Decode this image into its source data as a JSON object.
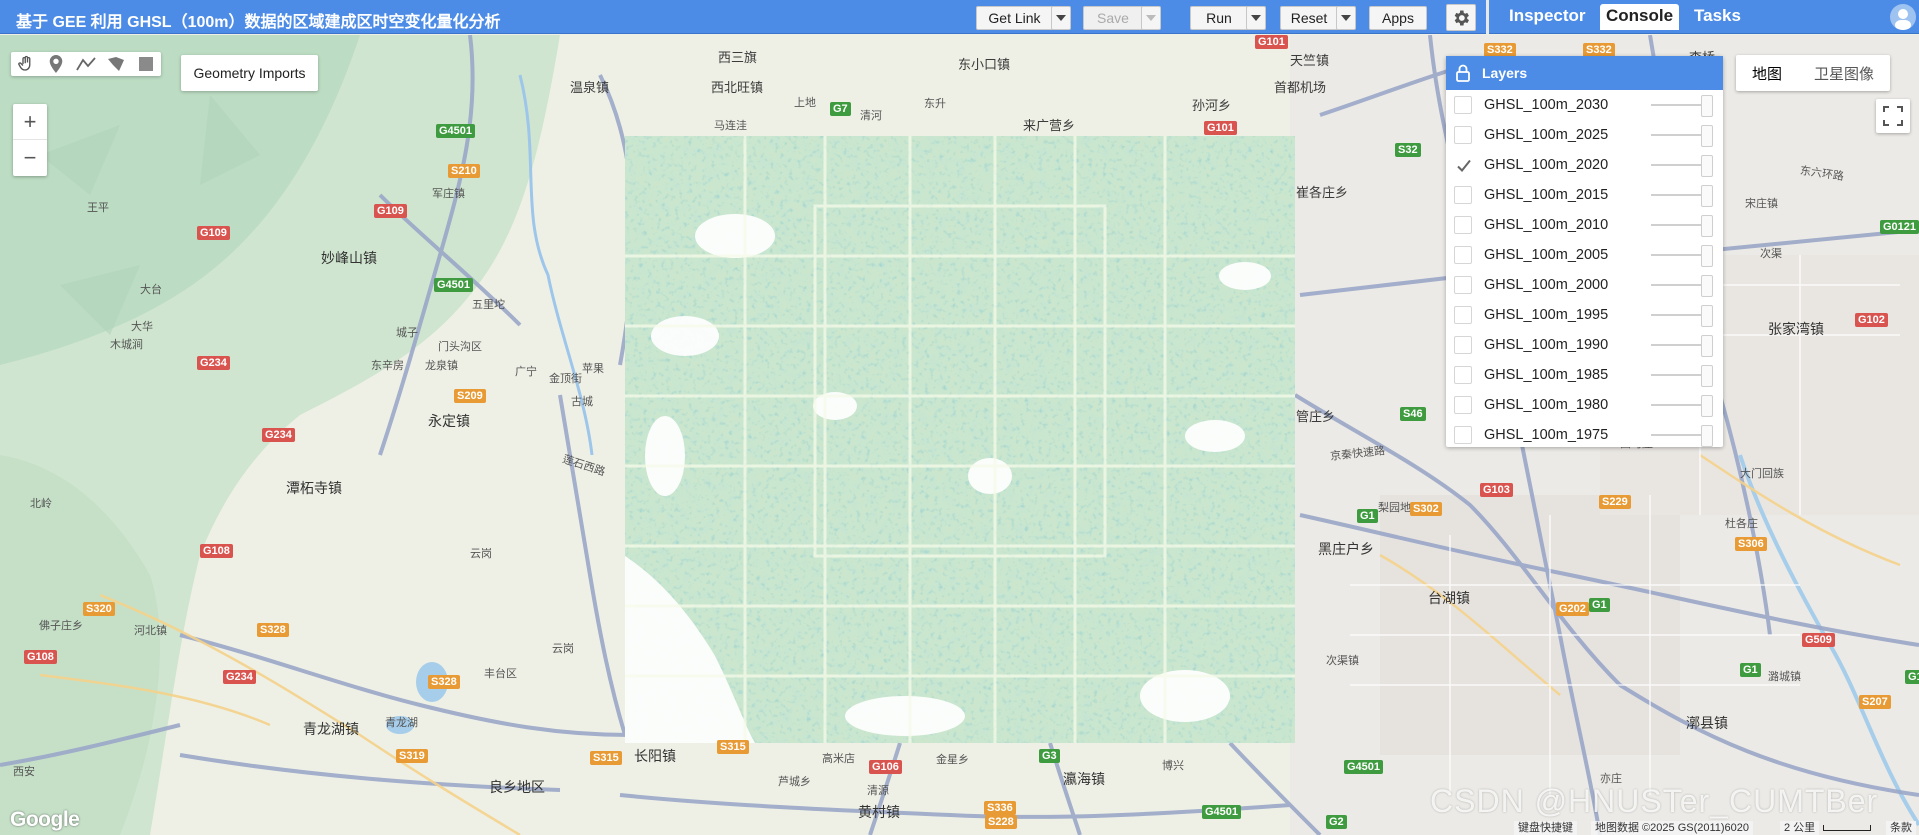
{
  "app": {
    "title": "基于 GEE 利用 GHSL（100m）数据的区域建成区时空变化量化分析"
  },
  "toolbar": {
    "get_link": "Get Link",
    "save": "Save",
    "run": "Run",
    "reset": "Reset",
    "apps": "Apps"
  },
  "tabs": [
    {
      "label": "Inspector"
    },
    {
      "label": "Console"
    },
    {
      "label": "Tasks"
    }
  ],
  "active_tab": "Console",
  "map_controls": {
    "geometry_imports": "Geometry Imports",
    "zoom_in": "+",
    "zoom_out": "−",
    "map_type": [
      "地图",
      "卫星图像"
    ],
    "selected_map_type": "地图"
  },
  "drawing_tools": [
    "hand-icon",
    "marker-icon",
    "polyline-icon",
    "polygon-icon",
    "rectangle-icon"
  ],
  "layers_panel": {
    "title": "Layers",
    "items": [
      {
        "name": "GHSL_100m_2030",
        "checked": false
      },
      {
        "name": "GHSL_100m_2025",
        "checked": false
      },
      {
        "name": "GHSL_100m_2020",
        "checked": true
      },
      {
        "name": "GHSL_100m_2015",
        "checked": false
      },
      {
        "name": "GHSL_100m_2010",
        "checked": false
      },
      {
        "name": "GHSL_100m_2005",
        "checked": false
      },
      {
        "name": "GHSL_100m_2000",
        "checked": false
      },
      {
        "name": "GHSL_100m_1995",
        "checked": false
      },
      {
        "name": "GHSL_100m_1990",
        "checked": false
      },
      {
        "name": "GHSL_100m_1985",
        "checked": false
      },
      {
        "name": "GHSL_100m_1980",
        "checked": false
      },
      {
        "name": "GHSL_100m_1975",
        "checked": false
      }
    ]
  },
  "map_labels": {
    "places": [
      "西三旗",
      "东小口镇",
      "天竺镇",
      "李桥",
      "温泉镇",
      "西北旺镇",
      "首都机场",
      "孙河乡",
      "马连洼",
      "上地",
      "清河",
      "东升",
      "来广营乡",
      "王平",
      "妙峰山镇",
      "军庄镇",
      "大台",
      "大华",
      "木城涧",
      "城子",
      "东辛房",
      "龙泉镇",
      "门头沟区",
      "五里坨",
      "广宁",
      "金顶街",
      "苹果",
      "古城",
      "永定镇",
      "潭柘寺镇",
      "北岭",
      "长阳镇",
      "云岗",
      "云岗",
      "丰台区",
      "佛子庄乡",
      "河北镇",
      "青龙湖镇",
      "青龙湖",
      "良乡地区",
      "西安",
      "高米店",
      "芦城乡",
      "黄村镇",
      "瀛海镇",
      "清源",
      "金星乡",
      "博兴",
      "崔各庄乡",
      "管庄乡",
      "黑庄户乡",
      "台湖镇",
      "梨园地区",
      "漷县镇",
      "次渠镇",
      "杜各庄",
      "大门回族",
      "张家湾镇",
      "宋庄镇",
      "潞城镇",
      "西马庄",
      "亦庄",
      "次渠"
    ],
    "road_shields": [
      "G4501",
      "S210",
      "G109",
      "G109",
      "G7",
      "G101",
      "G101",
      "G4501",
      "S209",
      "G234",
      "G234",
      "G108",
      "S320",
      "S328",
      "S328",
      "G234",
      "G108",
      "S319",
      "S315",
      "S315",
      "G106",
      "G3",
      "S336",
      "S228",
      "G4501",
      "G2",
      "G4501",
      "G1",
      "S32",
      "S332",
      "S332",
      "G0121",
      "G102",
      "S46",
      "G103",
      "S229",
      "S302",
      "G1",
      "S306",
      "G202",
      "G1",
      "G1",
      "S207",
      "G509"
    ],
    "road_names": [
      "东六环路",
      "京秦快速路",
      "莲石西路"
    ]
  },
  "attribution": {
    "keyboard": "键盘快捷键",
    "map_data": "地图数据 ©2025 GS(2011)6020",
    "scale": "2 公里",
    "terms": "条款"
  },
  "watermark": "CSDN @HNUSTer_CUMTBer",
  "colors": {
    "topbar": "#4d8ce6",
    "layer_ramp_light": "#f3f8e7",
    "layer_ramp_mid": "#8cc8a2",
    "layer_ramp_dark": "#2e8aa3"
  }
}
